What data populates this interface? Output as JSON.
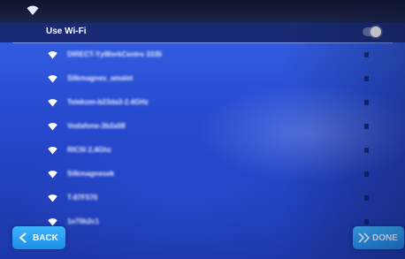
{
  "header": {
    "title": "Use Wi-Fi",
    "toggle_on": true
  },
  "networks": [
    {
      "ssid": "DIRECT-YyWorkCentre 3335",
      "icon": "wifi-icon",
      "secured": true
    },
    {
      "ssid": "Silkmagnes_amalet",
      "icon": "wifi-icon",
      "secured": true
    },
    {
      "ssid": "Telekom-b23da3-2.4GHz",
      "icon": "wifi-icon",
      "secured": true
    },
    {
      "ssid": "Vodafone-3b2a08",
      "icon": "wifi-icon",
      "secured": true
    },
    {
      "ssid": "RICSI 2,4Ghz",
      "icon": "wifi-icon",
      "secured": true
    },
    {
      "ssid": "Silkmagnesek",
      "icon": "wifi-icon",
      "secured": true
    },
    {
      "ssid": "T-87F570",
      "icon": "wifi-icon",
      "secured": true
    },
    {
      "ssid": "1e70b2c1",
      "icon": "wifi-icon",
      "secured": true
    }
  ],
  "buttons": {
    "back_label": "BACK",
    "done_label": "DONE"
  },
  "colors": {
    "accent": "#1d8de6",
    "header_bg": "#1a2a74",
    "background": "#2a4fd6"
  }
}
